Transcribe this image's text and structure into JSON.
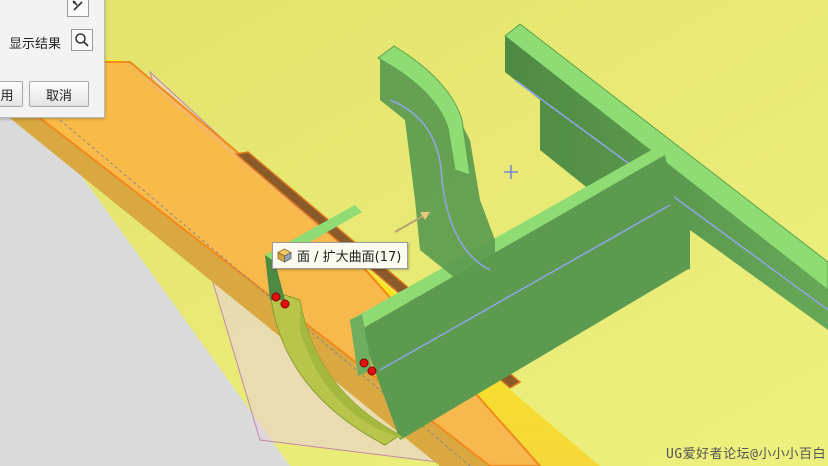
{
  "dialog": {
    "show_result_label": "显示结果",
    "apply_button_label": "用",
    "cancel_button_label": "取消",
    "magnifier_icon": "search-icon",
    "top_icon": "arrow-up-left-icon"
  },
  "tooltip": {
    "icon": "face-cube-icon",
    "text": "面 / 扩大曲面(17)"
  },
  "watermark": {
    "text": "UG爱好者论坛@小小小百白"
  },
  "colors": {
    "background": "#e6e876",
    "green_solid": "#5b9a4f",
    "green_top": "#8edc73",
    "orange_face": "#f7b253",
    "selection_point": "#e01010"
  }
}
